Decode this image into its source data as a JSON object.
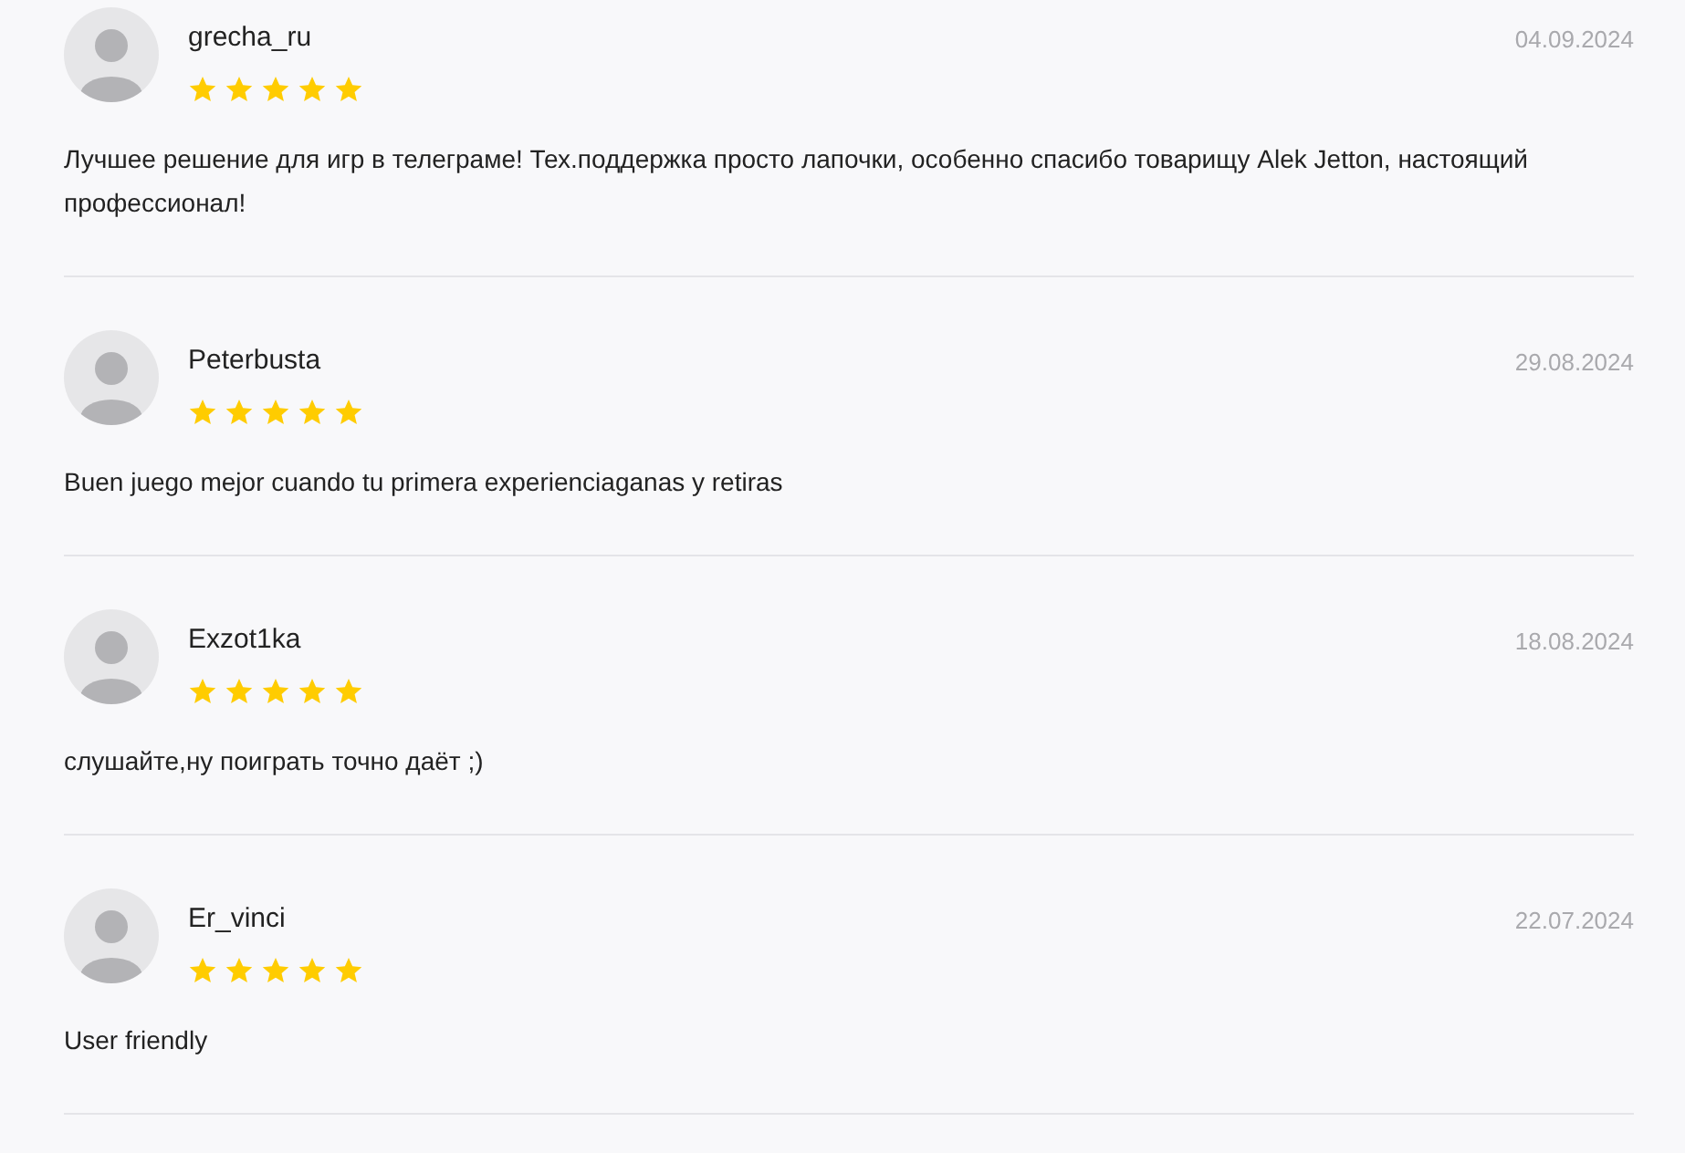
{
  "reviews": [
    {
      "author": "grecha_ru",
      "stars": 5,
      "date": "04.09.2024",
      "text": "Лучшее решение для игр в телеграме! Тех.поддержка просто лапочки, особенно спасибо товарищу Alek Jetton, настоящий профессионал!"
    },
    {
      "author": "Peterbusta",
      "stars": 5,
      "date": "29.08.2024",
      "text": "Buen juego mejor cuando tu primera experienciaganas y retiras"
    },
    {
      "author": "Exzot1ka",
      "stars": 5,
      "date": "18.08.2024",
      "text": "слушайте,ну поиграть точно даёт ;)"
    },
    {
      "author": "Er_vinci",
      "stars": 5,
      "date": "22.07.2024",
      "text": "User friendly"
    }
  ]
}
